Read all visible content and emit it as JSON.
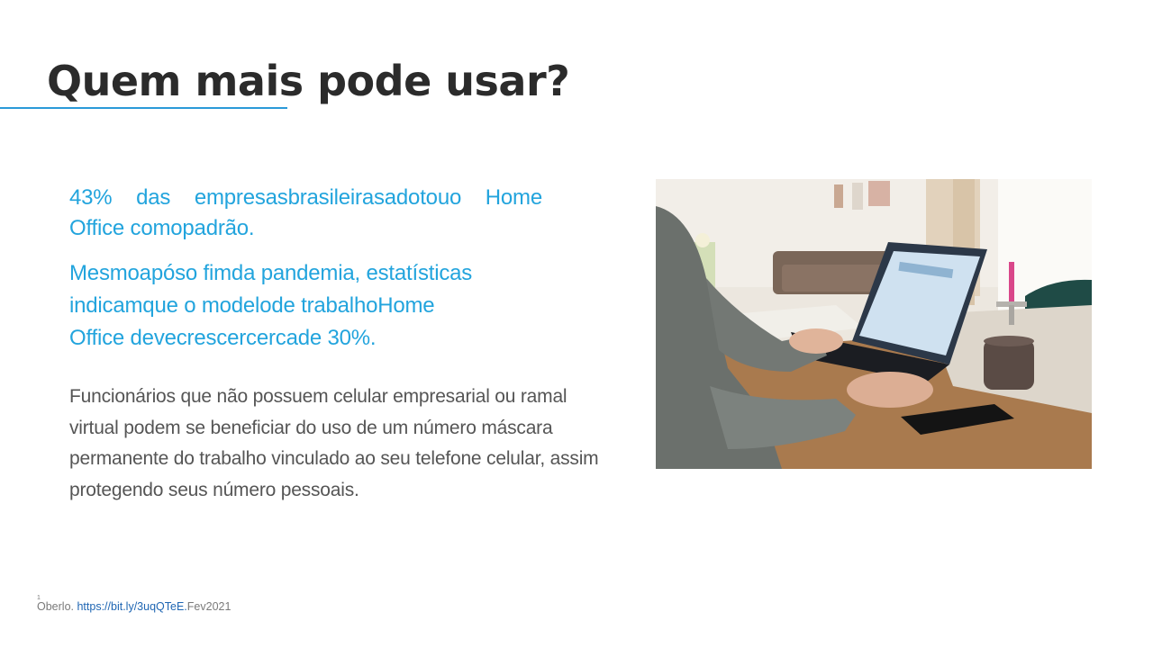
{
  "slide": {
    "title": "Quem mais pode usar?",
    "highlight_1": "43% das empresasbrasileirasadotouo Home Office comopadrão.",
    "highlight_2": "Mesmoapóso fimda pandemia, estatísticas\nindicamque o modelode trabalhoHome\nOffice devecrescercercade 30%.",
    "description": "Funcionários que não possuem celular empresarial ou ramal virtual podem se beneficiar do uso de um número máscara permanente do trabalho vinculado ao seu telefone celular, assim protegendo seus número pessoais."
  },
  "footnote": {
    "number": "1",
    "prefix": "Oberlo.",
    "link": "https://bit.ly/3uqQTeE.",
    "suffix": "Fev2021"
  },
  "colors": {
    "title": "#2b2b2b",
    "accent": "#22a4dd",
    "body_text": "#555555",
    "link": "#1f66b3"
  }
}
